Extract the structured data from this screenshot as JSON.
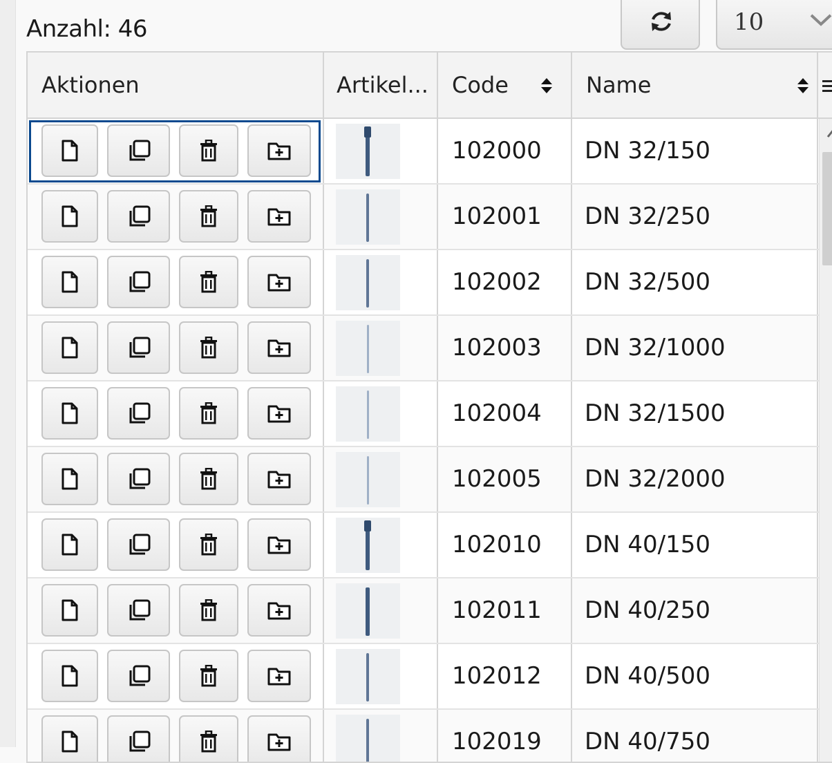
{
  "toolbar": {
    "count_text": "Anzahl: 46",
    "page_size": "10",
    "refresh_icon": "refresh-icon",
    "dropdown_icon": "chevron-down-icon"
  },
  "grid": {
    "columns": {
      "actions": "Aktionen",
      "article": "Artikel...",
      "code": "Code",
      "name": "Name"
    },
    "row_action_icons": [
      "new-document-icon",
      "copy-icon",
      "delete-icon",
      "add-to-folder-icon"
    ],
    "rows": [
      {
        "code": "102000",
        "name": "DN 32/150"
      },
      {
        "code": "102001",
        "name": "DN 32/250"
      },
      {
        "code": "102002",
        "name": "DN 32/500"
      },
      {
        "code": "102003",
        "name": "DN 32/1000"
      },
      {
        "code": "102004",
        "name": "DN 32/1500"
      },
      {
        "code": "102005",
        "name": "DN 32/2000"
      },
      {
        "code": "102010",
        "name": "DN 40/150"
      },
      {
        "code": "102011",
        "name": "DN 40/250"
      },
      {
        "code": "102012",
        "name": "DN 40/500"
      },
      {
        "code": "102019",
        "name": "DN 40/750"
      }
    ]
  },
  "colors": {
    "focus": "#0b4a8f",
    "pipe": "#3f5b7f",
    "border": "#d4d4d4"
  }
}
